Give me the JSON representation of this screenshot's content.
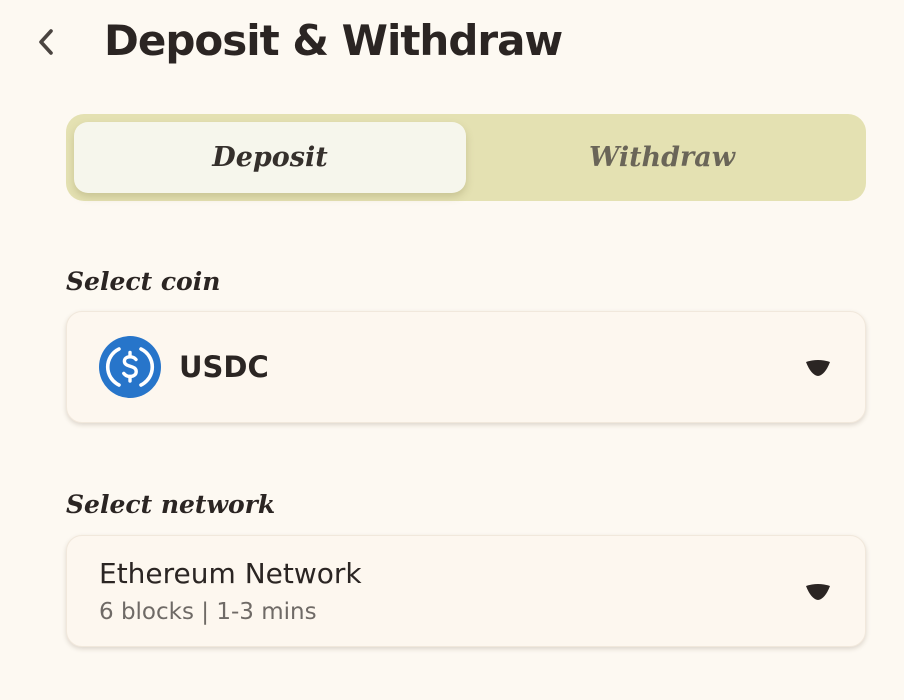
{
  "header": {
    "title": "Deposit & Withdraw",
    "back_icon": "chevron-left-icon"
  },
  "tabs": [
    {
      "label": "Deposit",
      "active": true
    },
    {
      "label": "Withdraw",
      "active": false
    }
  ],
  "coin_section": {
    "label": "Select coin",
    "selected": {
      "name": "USDC",
      "icon": "usdc-coin-icon",
      "icon_color": "#2775ca"
    },
    "dropdown_icon": "chevron-down-icon"
  },
  "network_section": {
    "label": "Select network",
    "selected": {
      "name": "Ethereum Network",
      "detail": "6 blocks | 1-3 mins"
    },
    "dropdown_icon": "chevron-down-icon"
  },
  "colors": {
    "background": "#fdf9f2",
    "tab_track": "#e4e1b2",
    "tab_active": "#f6f6ec",
    "text": "#2b2523"
  }
}
